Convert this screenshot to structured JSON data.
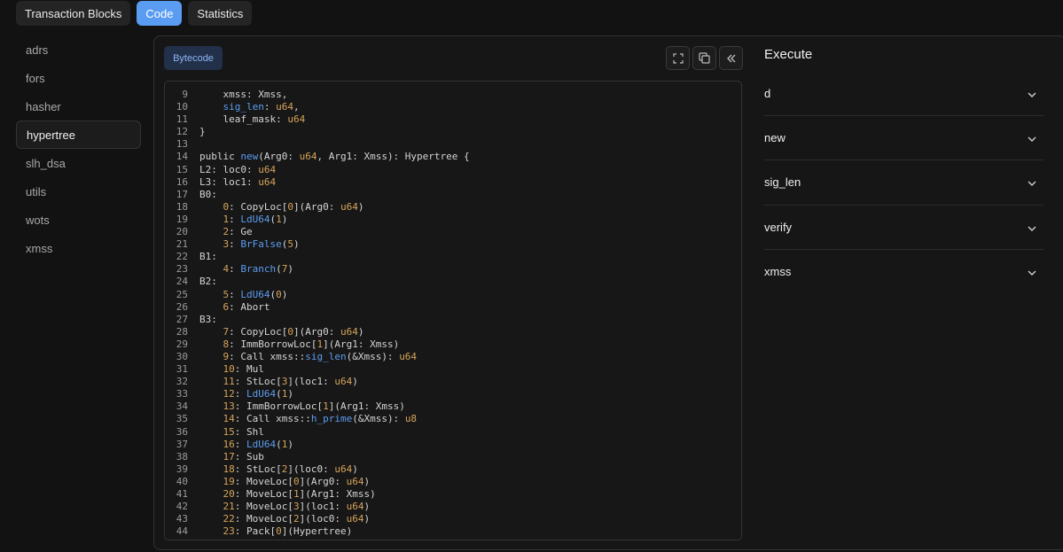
{
  "tabs": [
    {
      "label": "Transaction Blocks",
      "active": false
    },
    {
      "label": "Code",
      "active": true
    },
    {
      "label": "Statistics",
      "active": false
    }
  ],
  "sidebar": {
    "items": [
      {
        "label": "adrs"
      },
      {
        "label": "fors"
      },
      {
        "label": "hasher"
      },
      {
        "label": "hypertree",
        "active": true
      },
      {
        "label": "slh_dsa"
      },
      {
        "label": "utils"
      },
      {
        "label": "wots"
      },
      {
        "label": "xmss"
      }
    ]
  },
  "code_panel": {
    "bytecode_label": "Bytecode",
    "toolbar_icons": [
      "fullscreen-icon",
      "copy-icon",
      "collapse-icon"
    ],
    "lines": [
      {
        "n": "9",
        "text": "    xmss: Xmss,"
      },
      {
        "n": "10",
        "text": "    sig_len: u64,"
      },
      {
        "n": "11",
        "text": "    leaf_mask: u64"
      },
      {
        "n": "12",
        "text": "}"
      },
      {
        "n": "13",
        "text": ""
      },
      {
        "n": "14",
        "text": "public new(Arg0: u64, Arg1: Xmss): Hypertree {"
      },
      {
        "n": "15",
        "text": "L2: loc0: u64"
      },
      {
        "n": "16",
        "text": "L3: loc1: u64"
      },
      {
        "n": "17",
        "text": "B0:"
      },
      {
        "n": "18",
        "text": "    0: CopyLoc[0](Arg0: u64)"
      },
      {
        "n": "19",
        "text": "    1: LdU64(1)"
      },
      {
        "n": "20",
        "text": "    2: Ge"
      },
      {
        "n": "21",
        "text": "    3: BrFalse(5)"
      },
      {
        "n": "22",
        "text": "B1:"
      },
      {
        "n": "23",
        "text": "    4: Branch(7)"
      },
      {
        "n": "24",
        "text": "B2:"
      },
      {
        "n": "25",
        "text": "    5: LdU64(0)"
      },
      {
        "n": "26",
        "text": "    6: Abort"
      },
      {
        "n": "27",
        "text": "B3:"
      },
      {
        "n": "28",
        "text": "    7: CopyLoc[0](Arg0: u64)"
      },
      {
        "n": "29",
        "text": "    8: ImmBorrowLoc[1](Arg1: Xmss)"
      },
      {
        "n": "30",
        "text": "    9: Call xmss::sig_len(&Xmss): u64"
      },
      {
        "n": "31",
        "text": "    10: Mul"
      },
      {
        "n": "32",
        "text": "    11: StLoc[3](loc1: u64)"
      },
      {
        "n": "33",
        "text": "    12: LdU64(1)"
      },
      {
        "n": "34",
        "text": "    13: ImmBorrowLoc[1](Arg1: Xmss)"
      },
      {
        "n": "35",
        "text": "    14: Call xmss::h_prime(&Xmss): u8"
      },
      {
        "n": "36",
        "text": "    15: Shl"
      },
      {
        "n": "37",
        "text": "    16: LdU64(1)"
      },
      {
        "n": "38",
        "text": "    17: Sub"
      },
      {
        "n": "39",
        "text": "    18: StLoc[2](loc0: u64)"
      },
      {
        "n": "40",
        "text": "    19: MoveLoc[0](Arg0: u64)"
      },
      {
        "n": "41",
        "text": "    20: MoveLoc[1](Arg1: Xmss)"
      },
      {
        "n": "42",
        "text": "    21: MoveLoc[3](loc1: u64)"
      },
      {
        "n": "43",
        "text": "    22: MoveLoc[2](loc0: u64)"
      },
      {
        "n": "44",
        "text": "    23: Pack[0](Hypertree)"
      }
    ]
  },
  "execute": {
    "title": "Execute",
    "functions": [
      {
        "label": "d"
      },
      {
        "label": "new"
      },
      {
        "label": "sig_len"
      },
      {
        "label": "verify"
      },
      {
        "label": "xmss"
      }
    ],
    "expand_icon": "chevron-down-icon"
  },
  "colors": {
    "accent": "#5b9cf3",
    "type": "#d6a45a",
    "call": "#5c9cf0"
  }
}
